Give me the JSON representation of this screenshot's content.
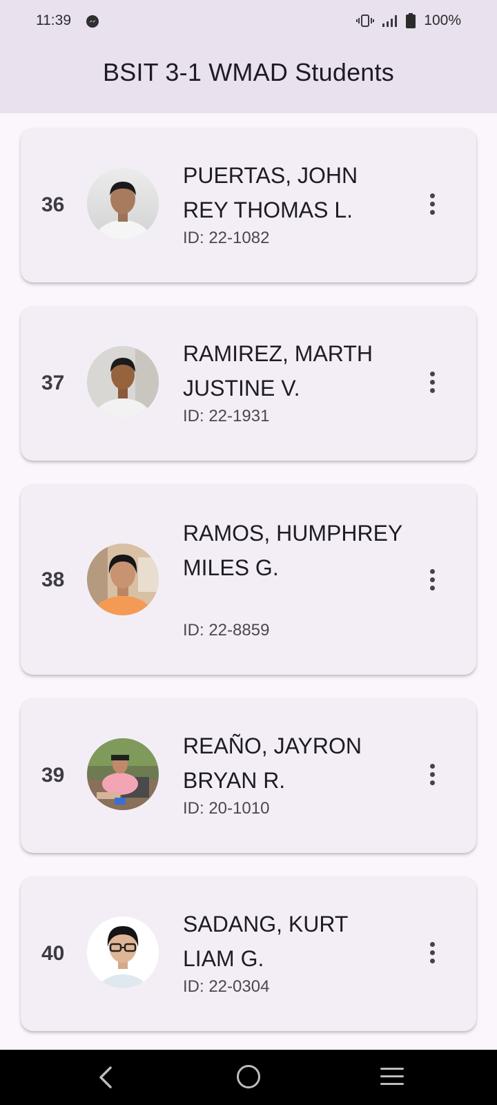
{
  "status_bar": {
    "time": "11:39",
    "battery": "100%",
    "icons": [
      "messenger-icon",
      "vibrate-icon",
      "signal-icon",
      "battery-icon"
    ]
  },
  "app_bar": {
    "title": "BSIT 3-1 WMAD Students"
  },
  "students": [
    {
      "number": "36",
      "name": "PUERTAS, JOHN REY THOMAS L.",
      "id": "ID: 22-1082"
    },
    {
      "number": "37",
      "name": "RAMIREZ, MARTH JUSTINE V.",
      "id": "ID: 22-1931"
    },
    {
      "number": "38",
      "name": "RAMOS, HUMPHREY MILES G.",
      "id": "ID: 22-8859"
    },
    {
      "number": "39",
      "name": "REAÑO, JAYRON BRYAN R.",
      "id": "ID: 20-1010"
    },
    {
      "number": "40",
      "name": "SADANG, KURT LIAM G.",
      "id": "ID: 22-0304"
    }
  ],
  "nav_bar": {
    "icons": [
      "back-icon",
      "home-icon",
      "recents-icon"
    ]
  },
  "colors": {
    "app_bar": "#e9e1ee",
    "background": "#fbf5fc",
    "card": "#f3eef6"
  }
}
